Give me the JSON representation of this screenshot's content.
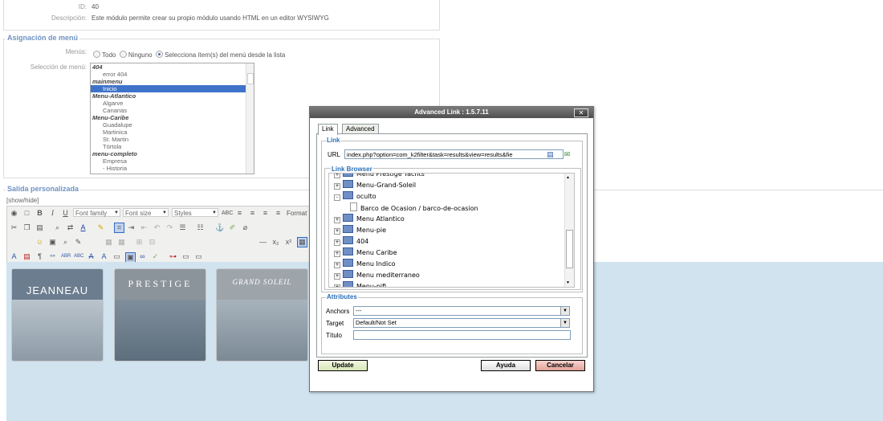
{
  "module_details": {
    "id_label": "ID:",
    "id_value": "40",
    "description_label": "Descripción:",
    "description_value": "Este módulo permite crear su propio módulo usando HTML en un editor WYSIWYG"
  },
  "menu_assignment": {
    "legend": "Asignación de menú",
    "menus_label": "Menús:",
    "radio_all": "Todo",
    "radio_none": "Ninguno",
    "radio_select": "Selecciona ítem(s) del menú desde la lista",
    "selection_label": "Selección de menú:",
    "items": [
      {
        "text": "404",
        "type": "group"
      },
      {
        "text": "error 404",
        "type": "option"
      },
      {
        "text": "mainmenu",
        "type": "group"
      },
      {
        "text": "Inicio",
        "type": "option",
        "selected": true
      },
      {
        "text": "Menu-Atlantico",
        "type": "group"
      },
      {
        "text": "Algarve",
        "type": "option"
      },
      {
        "text": "Canarias",
        "type": "option"
      },
      {
        "text": "Menu-Caribe",
        "type": "group"
      },
      {
        "text": "Guadalupe",
        "type": "option"
      },
      {
        "text": "Martinica",
        "type": "option"
      },
      {
        "text": "St. Martin",
        "type": "option"
      },
      {
        "text": "Tórtola",
        "type": "option"
      },
      {
        "text": "menu-completo",
        "type": "group"
      },
      {
        "text": "Empresa",
        "type": "option"
      },
      {
        "text": "- Historia",
        "type": "option"
      }
    ]
  },
  "custom_output": {
    "legend": "Salida personalizada",
    "show_hide": "[show/hide]"
  },
  "toolbar": {
    "font_family": "Font family",
    "font_size": "Font size",
    "styles": "Styles",
    "format": "Format"
  },
  "brands": [
    "JEANNEAU",
    "PRESTIGE",
    "GRAND SOLEIL"
  ],
  "dialog": {
    "title": "Advanced Link : 1.5.7.11",
    "close": "✕",
    "tabs": [
      "Link",
      "Advanced"
    ],
    "link_legend": "Link",
    "url_label": "URL",
    "url_value": "index.php?option=com_k2filter&task=results&view=results&fie",
    "browser_legend": "Link Browser",
    "tree": [
      {
        "text": "Menu Prestige Yachts",
        "level": 0,
        "kind": "folder",
        "toggle": "+"
      },
      {
        "text": "Menu-Grand-Soleil",
        "level": 0,
        "kind": "folder",
        "toggle": "+"
      },
      {
        "text": "oculto",
        "level": 0,
        "kind": "folder",
        "toggle": "-"
      },
      {
        "text": "Barco de Ocasion / barco-de-ocasion",
        "level": 1,
        "kind": "page",
        "toggle": ""
      },
      {
        "text": "Menu Atlantico",
        "level": 0,
        "kind": "folder",
        "toggle": "+"
      },
      {
        "text": "Menu-pie",
        "level": 0,
        "kind": "folder",
        "toggle": "+"
      },
      {
        "text": "404",
        "level": 0,
        "kind": "folder",
        "toggle": "+"
      },
      {
        "text": "Menu Caribe",
        "level": 0,
        "kind": "folder",
        "toggle": "+"
      },
      {
        "text": "Menu Indico",
        "level": 0,
        "kind": "folder",
        "toggle": "+"
      },
      {
        "text": "Menu mediterraneo",
        "level": 0,
        "kind": "folder",
        "toggle": "+"
      },
      {
        "text": "Menu-pifi",
        "level": 0,
        "kind": "folder",
        "toggle": "+"
      }
    ],
    "attributes_legend": "Attributes",
    "anchors_label": "Anchors",
    "anchors_value": "---",
    "target_label": "Target",
    "target_value": "Default/Not Set",
    "title_label": "Título",
    "title_value": "",
    "update_button": "Update",
    "help_button": "Ayuda",
    "cancel_button": "Cancelar"
  }
}
